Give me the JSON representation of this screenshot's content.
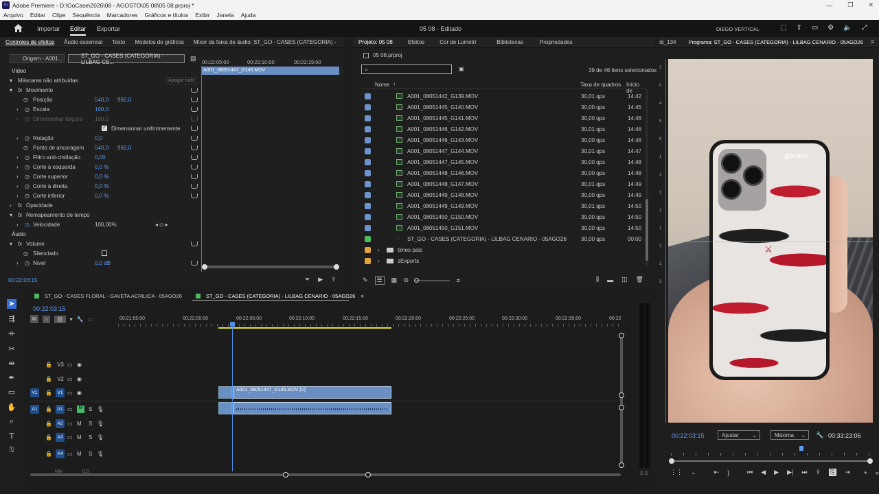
{
  "titlebar": {
    "app": "Adobe Premiere - D:\\GoCase\\2026\\08 - AGOSTO\\05 08\\05 08.prproj *"
  },
  "menu": [
    "Arquivo",
    "Editar",
    "Clipe",
    "Sequência",
    "Marcadores",
    "Gráficos e títulos",
    "Exibir",
    "Janela",
    "Ajuda"
  ],
  "topbar": {
    "tabs": [
      "Importar",
      "Editar",
      "Exportar"
    ],
    "active": "Editar",
    "center_title": "05 08 - Editado",
    "workspace": "DIEGO VERTICAL"
  },
  "effects_panel": {
    "tabs": [
      "Controles de efeitos",
      "Áudio essencial",
      "Texto",
      "Modelos de gráficos",
      "Mixer da faixa de áudio: ST_GO - CASES (CATEGORIA) -"
    ],
    "source_tab": "Origem - A001...",
    "seq_tab": "ST_GO - CASES (CATEGORIA) - LILBAG CE...",
    "ruler": [
      "00:22:05:00",
      "00:22:10:00",
      "00:22:15:00"
    ],
    "clip_label": "A001_08051447_G145.MOV",
    "video_header": "Vídeo",
    "masks": "Máscaras não atribuídas",
    "erase_all": "Apagar tudo",
    "motion": "Movimento",
    "position": {
      "label": "Posição",
      "x": "540,0",
      "y": "960,0"
    },
    "scale": {
      "label": "Escala",
      "value": "100,0"
    },
    "scale_width": {
      "label": "Dimensionar largura",
      "value": "100,0"
    },
    "uniform": "Dimensionar uniformemente",
    "rotation": {
      "label": "Rotação",
      "value": "0,0"
    },
    "anchor": {
      "label": "Ponto de ancoragem",
      "x": "540,0",
      "y": "960,0"
    },
    "antiflicker": {
      "label": "Filtro anti-cintilação",
      "value": "0,00"
    },
    "crop_left": {
      "label": "Corte à esquerda",
      "value": "0,0 %"
    },
    "crop_top": {
      "label": "Corte superior",
      "value": "0,0 %"
    },
    "crop_right": {
      "label": "Corte à direita",
      "value": "0,0 %"
    },
    "crop_bottom": {
      "label": "Corte inferior",
      "value": "0,0 %"
    },
    "opacity": "Opacidade",
    "time_remap": "Remapeamento de tempo",
    "speed": {
      "label": "Velocidade",
      "value": "100,00%"
    },
    "audio_header": "Áudio",
    "volume": "Volume",
    "mute": "Silenciado",
    "level": {
      "label": "Nível",
      "value": "0,0 dB"
    },
    "timecode": "00:22:03:15"
  },
  "project_panel": {
    "tabs": [
      "Projeto: 05 08",
      "Efeitos",
      "Cor de Lumetri",
      "Bibliotecas",
      "Propriedades"
    ],
    "file": "05 08.prproj",
    "search_placeholder": "",
    "selection": "39 de 46 itens selecionados",
    "columns": {
      "name": "Nome",
      "rate": "Taxa de quadros",
      "start": "Início de"
    },
    "clips": [
      {
        "name": "A001_08051442_G139.MOV",
        "rate": "30,01 qps",
        "start": "14:42"
      },
      {
        "name": "A001_08051445_G140.MOV",
        "rate": "30,00 qps",
        "start": "14:45"
      },
      {
        "name": "A001_08051445_G141.MOV",
        "rate": "30,00 qps",
        "start": "14:46"
      },
      {
        "name": "A001_08051446_G142.MOV",
        "rate": "30,01 qps",
        "start": "14:46"
      },
      {
        "name": "A001_08051446_G143.MOV",
        "rate": "30,00 qps",
        "start": "14:46"
      },
      {
        "name": "A001_08051447_G144.MOV",
        "rate": "30,01 qps",
        "start": "14:47"
      },
      {
        "name": "A001_08051447_G145.MOV",
        "rate": "30,00 qps",
        "start": "14:48"
      },
      {
        "name": "A001_08051448_G146.MOV",
        "rate": "30,00 qps",
        "start": "14:48"
      },
      {
        "name": "A001_08051448_G147.MOV",
        "rate": "30,01 qps",
        "start": "14:49"
      },
      {
        "name": "A001_08051449_G148.MOV",
        "rate": "30,00 qps",
        "start": "14:49"
      },
      {
        "name": "A001_08051449_G149.MOV",
        "rate": "30,01 qps",
        "start": "14:50"
      },
      {
        "name": "A001_08051450_G150.MOV",
        "rate": "30,00 qps",
        "start": "14:50"
      },
      {
        "name": "A001_08051450_G151.MOV",
        "rate": "30,00 qps",
        "start": "14:50"
      }
    ],
    "sequence": {
      "name": "ST_GO - CASES (CATEGORIA) - LILBAG CENARIO - 05AGO26",
      "rate": "30,00 qps",
      "start": "00:00"
    },
    "folders": [
      "times pais",
      "zExports"
    ],
    "colors": {
      "clip": "#6c93cc",
      "sequence": "#4dbb5f",
      "folder": "#e0a43a"
    }
  },
  "program_monitor": {
    "side_tab": "ıb_134",
    "title": "Programa: ST_GO - CASES (CATEGORIA) - LILBAG CENARIO - 05AGO26",
    "timecode": "00:22:03:15",
    "fit": "Ajustar",
    "quality": "Máxima",
    "duration": "00:33:23:06",
    "brand": "gocase"
  },
  "timeline": {
    "seq_tabs": [
      "ST_GO - CASES FLORAL - GAVETA ACRILICA - 05AGO26",
      "ST_GO - CASES (CATEGORIA) - LILBAG CENARIO - 05AGO26"
    ],
    "timecode": "00:22:03:15",
    "ruler": [
      "00:21:55:00",
      "00:22:00:00",
      "00:22:05:00",
      "00:22:10:00",
      "00:22:15:00",
      "00:22:20:00",
      "00:22:25:00",
      "00:22:30:00",
      "00:22:35:00",
      "00:22"
    ],
    "video_tracks": [
      "V3",
      "V2",
      "V1"
    ],
    "audio_tracks": [
      "A1",
      "A2",
      "A3",
      "A4"
    ],
    "clip_video": "A001_08051447_G145.MOV [V]",
    "mix_label": "Mix",
    "mix_value": "0,0",
    "toggles": {
      "mute": "M",
      "solo": "S"
    }
  }
}
